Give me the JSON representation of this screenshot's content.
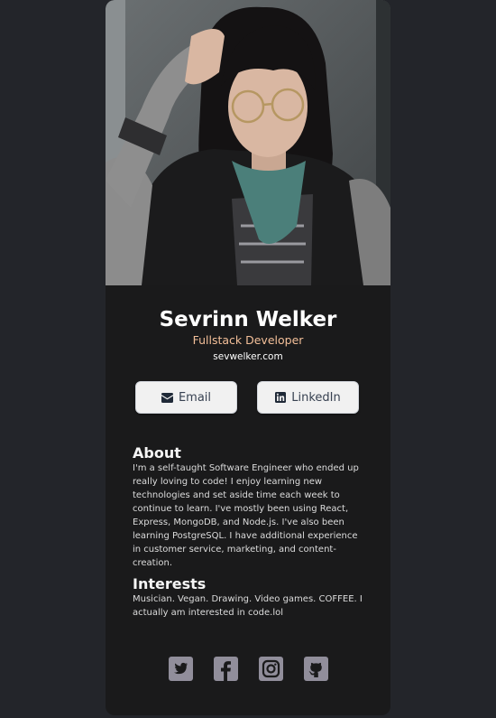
{
  "profile": {
    "name": "Sevrinn Welker",
    "title": "Fullstack Developer",
    "website": "sevwelker.com"
  },
  "buttons": {
    "email_label": "Email",
    "email_icon": "envelope-icon",
    "linkedin_label": "LinkedIn",
    "linkedin_icon": "linkedin-icon"
  },
  "about": {
    "heading": "About",
    "text": "I'm a self-taught Software Engineer who ended up really loving to code! I enjoy learning new technologies and set aside time each week to continue to learn. I've mostly been using React, Express, MongoDB, and Node.js. I've also been learning PostgreSQL. I have additional experience in customer service, marketing, and content-creation."
  },
  "interests": {
    "heading": "Interests",
    "text": "Musician. Vegan. Drawing. Video games. COFFEE. I actually am interested in code.lol"
  },
  "footer": {
    "icons": [
      "twitter-icon",
      "facebook-icon",
      "instagram-icon",
      "github-icon"
    ]
  },
  "colors": {
    "page_background": "#23252a",
    "card_background": "#1a1a1b",
    "accent_title": "#f3bf99",
    "button_background": "#f1f1f1",
    "icon_color": "#918e9b"
  }
}
